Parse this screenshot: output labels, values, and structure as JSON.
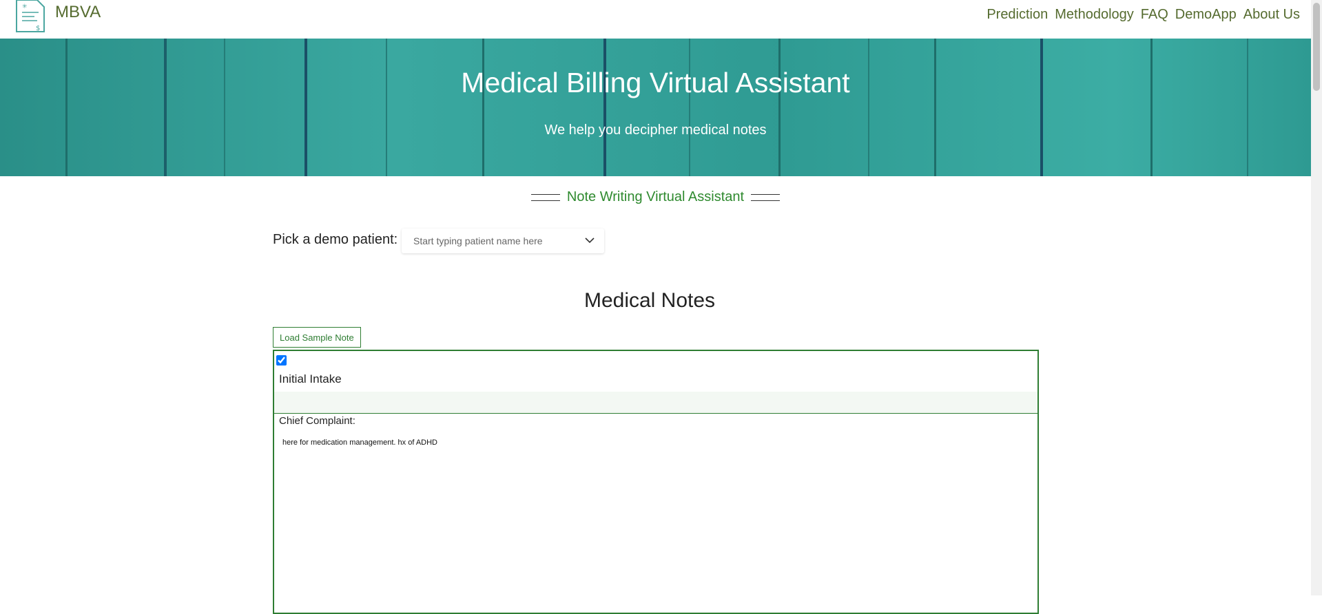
{
  "navbar": {
    "brand": "MBVA",
    "logo_icon": "medical-document-icon",
    "links": [
      "Prediction",
      "Methodology",
      "FAQ",
      "DemoApp",
      "About Us"
    ],
    "link_color": "#556b2f"
  },
  "hero": {
    "title": "Medical Billing Virtual Assistant",
    "subtitle": "We help you decipher medical notes",
    "background_color": "#2e9a92"
  },
  "assistant": {
    "heading": "Note Writing Virtual Assistant",
    "pick_label": "Pick a demo patient:",
    "patient_select": {
      "placeholder": "Start typing patient name here",
      "icon": "chevron-down-icon"
    }
  },
  "notes": {
    "title": "Medical Notes",
    "load_button": "Load Sample Note",
    "checkbox_checked": true,
    "note_type": "Initial Intake",
    "chief_complaint_label": "Chief Complaint:",
    "chief_complaint_text": "here for medication management. hx of ADHD",
    "accent_color": "#2e7d32"
  }
}
